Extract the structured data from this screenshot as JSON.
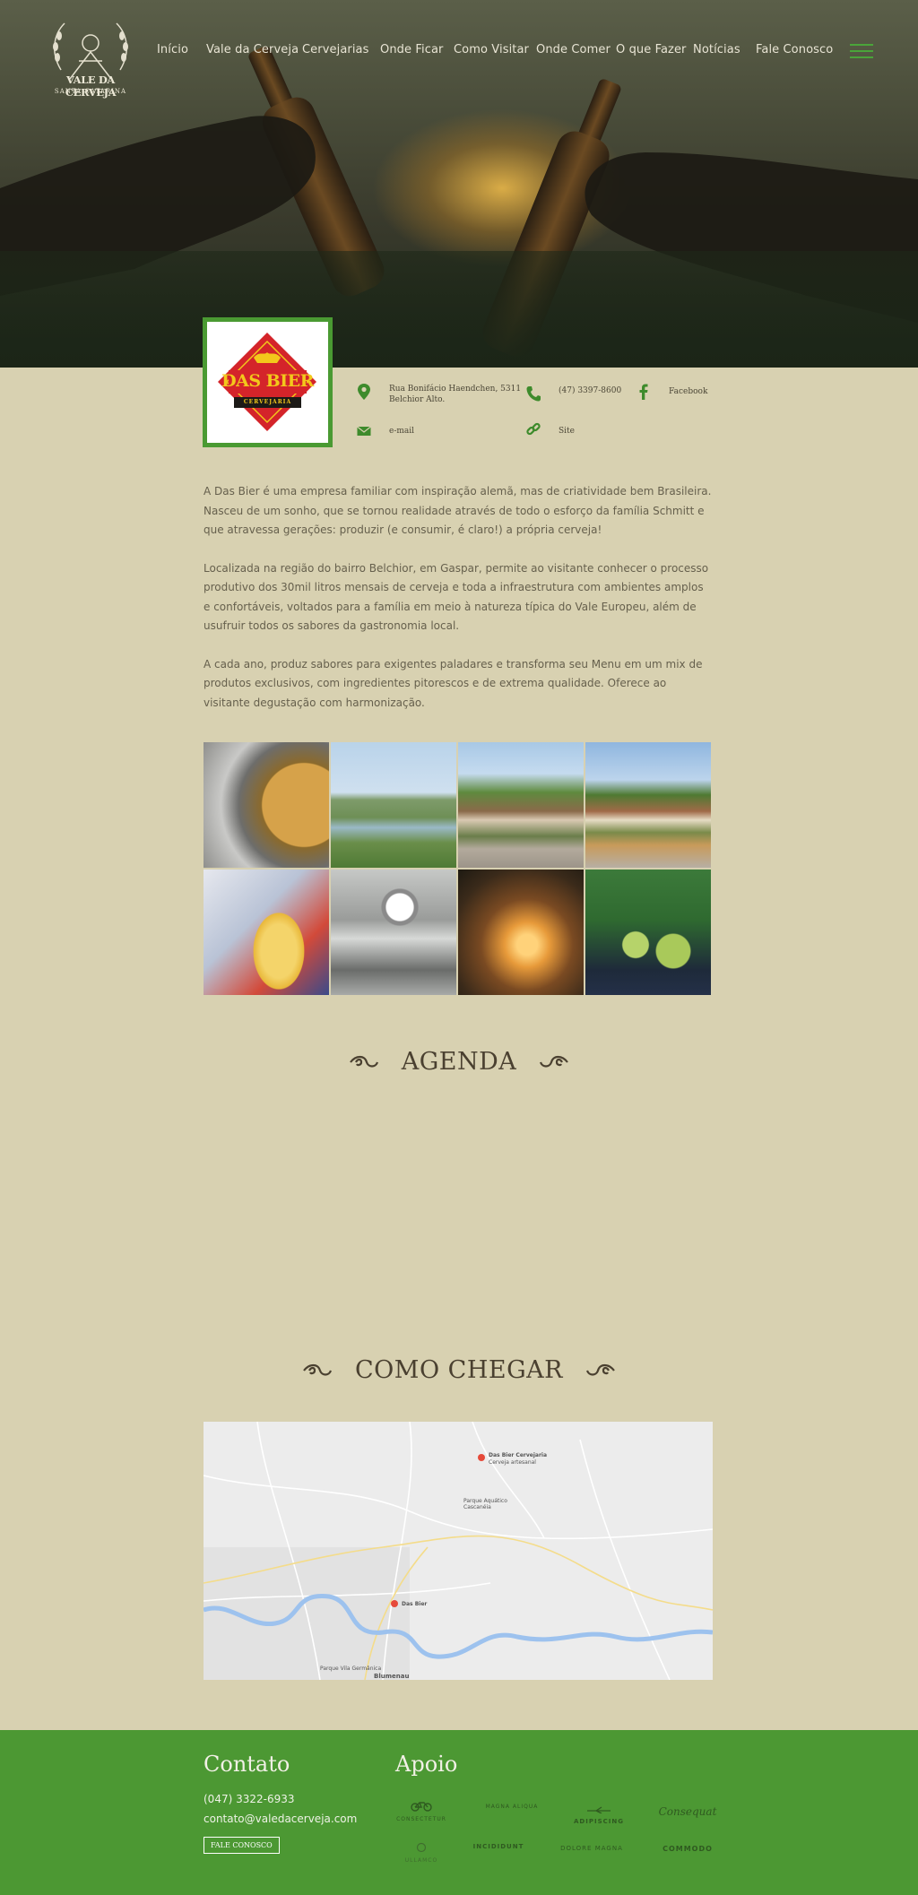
{
  "brand": {
    "logo_line1": "VALE DA CERVEJA",
    "logo_line2": "SANTA CATARINA"
  },
  "nav": {
    "items": [
      {
        "label": "Início"
      },
      {
        "label": "Vale da Cerveja"
      },
      {
        "label": "Cervejarias"
      },
      {
        "label": "Onde Ficar"
      },
      {
        "label": "Como Visitar"
      },
      {
        "label": "Onde Comer"
      },
      {
        "label": "O que Fazer"
      },
      {
        "label": "Notícias"
      },
      {
        "label": "Fale Conosco"
      }
    ],
    "menu_icon": "hamburger-icon"
  },
  "brewery": {
    "logo_text": "DAS BIER",
    "logo_subtext": "CERVEJARIA",
    "address_line1": "Rua Bonifácio Haendchen, 5311",
    "address_line2": "Belchior Alto.",
    "phone": "(47) 3397-8600",
    "facebook_label": "Facebook",
    "email_label": "e-mail",
    "site_label": "Site"
  },
  "description": {
    "paragraphs": [
      "A Das Bier é uma empresa familiar com inspiração alemã, mas de criatividade bem Brasileira. Nasceu de um sonho, que se tornou realidade através de todo o esforço da família Schmitt e que atravessa gerações: produzir (e consumir, é claro!) a própria cerveja!",
      "Localizada na região do bairro Belchior, em Gaspar, permite ao visitante conhecer o processo produtivo dos 30mil litros mensais de cerveja e toda a infraestrutura com ambientes amplos e confortáveis, voltados para a família em meio à natureza típica do Vale Europeu, além de usufruir todos os sabores da gastronomia local.",
      "A cada ano, produz sabores para exigentes paladares e transforma seu Menu em um mix de produtos exclusivos, com ingredientes pitorescos e de extrema qualidade. Oferece ao visitante degustação com harmonização."
    ]
  },
  "sections": {
    "agenda_title": "AGENDA",
    "directions_title": "COMO CHEGAR"
  },
  "map": {
    "pin1_label": "Das Bier Cervejaria",
    "pin1_sub": "Cerveja artesanal",
    "place1": "Parque Aquático Cascanéia",
    "pin2_label": "Das Bier",
    "place2": "Parque Vila Germânica",
    "city": "Blumenau"
  },
  "footer": {
    "contact_title": "Contato",
    "phone": "(047) 3322-6933",
    "email": "contato@valedacerveja.com",
    "contact_button": "FALE CONOSCO",
    "support_title": "Apoio",
    "sponsors": [
      "CONSECTETUR",
      "MAGNA ALIQUA",
      "ADIPISCING",
      "Consequat",
      "ULLAMCO",
      "INCIDIDUNT",
      "DOLORE MAGNA",
      "COMMODO"
    ]
  },
  "colors": {
    "accent_green": "#4c9833",
    "background": "#d8d1b1",
    "logo_red": "#d4242a",
    "logo_yellow": "#f3c81b"
  }
}
